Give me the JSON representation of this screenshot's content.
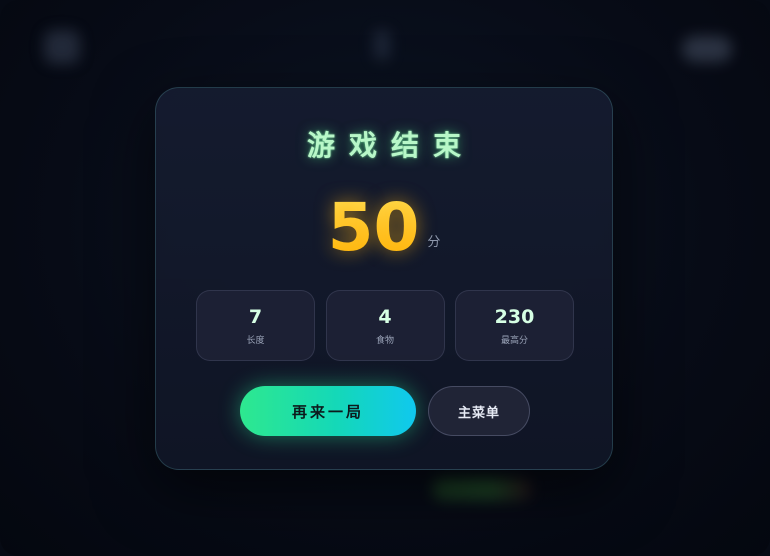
{
  "game_over": {
    "title": "游戏结束",
    "score": "50",
    "score_unit": "分",
    "stats": [
      {
        "value": "7",
        "label": "长度"
      },
      {
        "value": "4",
        "label": "食物"
      },
      {
        "value": "230",
        "label": "最高分"
      }
    ],
    "buttons": {
      "play_again": "再来一局",
      "main_menu": "主菜单"
    }
  },
  "colors": {
    "title": "#b8f7c8",
    "score": "#ffc21a",
    "primary_gradient_start": "#2ee88f",
    "primary_gradient_end": "#10c8ee",
    "card_border": "#5aa0aa"
  }
}
